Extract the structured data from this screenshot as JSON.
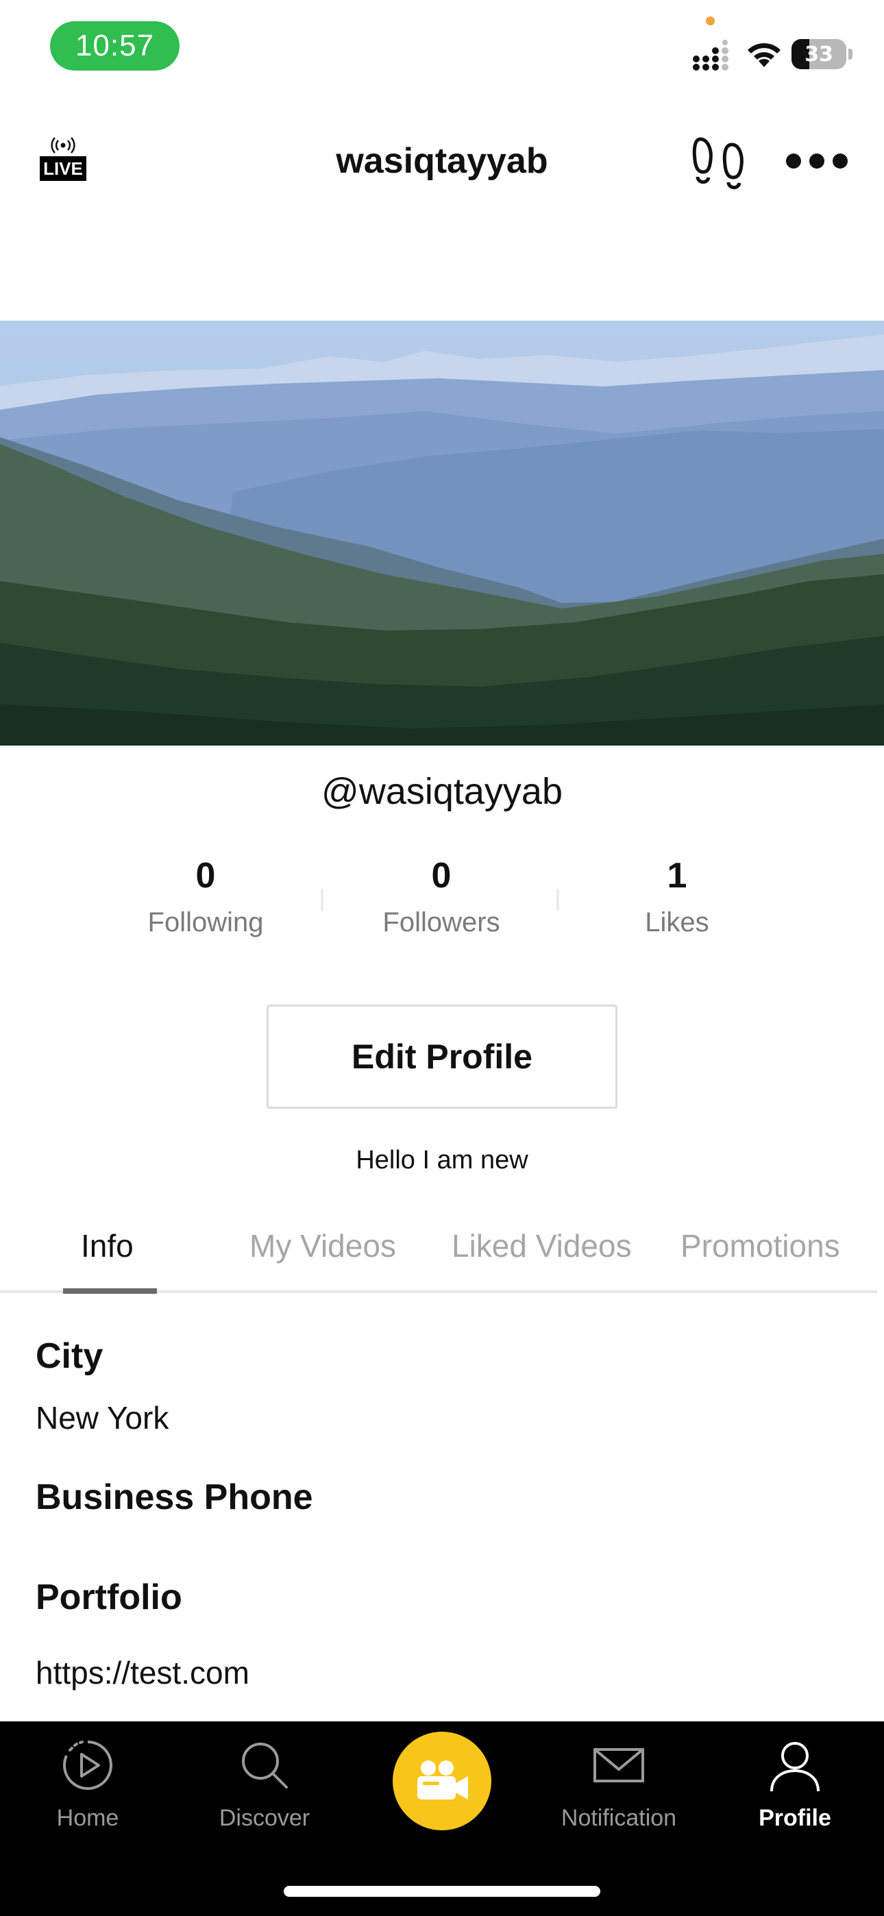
{
  "status_bar": {
    "time": "10:57",
    "battery": "33"
  },
  "header": {
    "live_label": "LIVE",
    "title": "wasiqtayyab"
  },
  "profile": {
    "handle": "@wasiqtayyab",
    "stats": [
      {
        "value": "0",
        "label": "Following"
      },
      {
        "value": "0",
        "label": "Followers"
      },
      {
        "value": "1",
        "label": "Likes"
      }
    ],
    "edit_button_label": "Edit Profile",
    "bio": "Hello I am new"
  },
  "tabs": [
    {
      "label": "Info",
      "active": true
    },
    {
      "label": "My Videos",
      "active": false
    },
    {
      "label": "Liked Videos",
      "active": false
    },
    {
      "label": "Promotions",
      "active": false
    }
  ],
  "info": {
    "city_label": "City",
    "city_value": "New York",
    "business_phone_label": "Business Phone",
    "business_phone_value": "",
    "portfolio_label": "Portfolio",
    "portfolio_value": "https://test.com"
  },
  "bottom_nav": [
    {
      "label": "Home",
      "icon": "play-circle-icon"
    },
    {
      "label": "Discover",
      "icon": "search-icon"
    },
    {
      "label": "",
      "icon": "video-camera-icon"
    },
    {
      "label": "Notification",
      "icon": "envelope-icon"
    },
    {
      "label": "Profile",
      "icon": "person-icon"
    }
  ],
  "colors": {
    "time_pill": "#2fbe4f",
    "record_button": "#f8c61b",
    "nav_background": "#000000"
  }
}
